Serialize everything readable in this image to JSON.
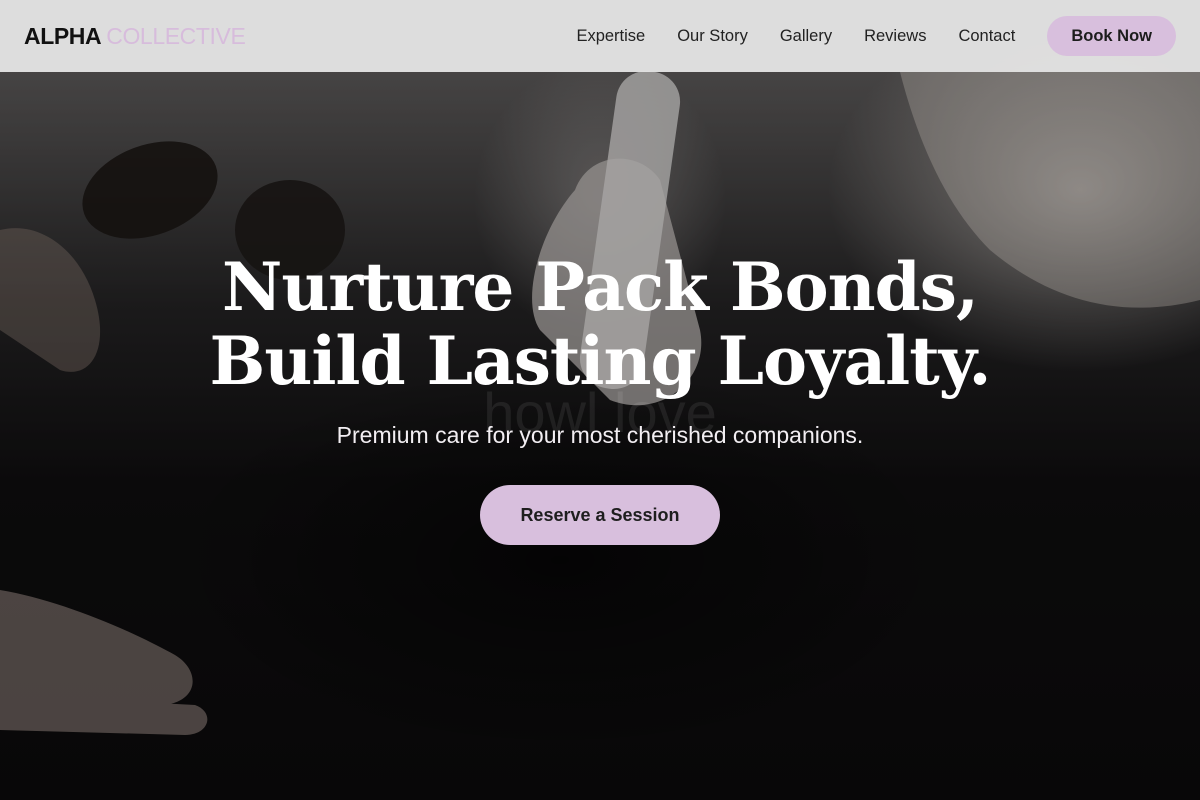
{
  "brand": {
    "primary": "ALPHA",
    "accent": "COLLECTIVE",
    "accent_color": "#d7bcdc"
  },
  "nav": {
    "items": [
      {
        "label": "Expertise"
      },
      {
        "label": "Our Story"
      },
      {
        "label": "Gallery"
      },
      {
        "label": "Reviews"
      },
      {
        "label": "Contact"
      }
    ],
    "cta_label": "Book Now"
  },
  "hero": {
    "title_line1": "Nurture Pack Bonds,",
    "title_line2": "Build Lasting Loyalty.",
    "background_watermark": "howl love",
    "subtitle": "Premium care for your most cherished companions.",
    "cta_label": "Reserve a Session",
    "image_description": "Dark photo of a dog lying on its back receiving care from gloved hands"
  },
  "colors": {
    "accent": "#d8bfdd",
    "navbar_bg": "#e2e2e2",
    "hero_text": "#ffffff"
  }
}
